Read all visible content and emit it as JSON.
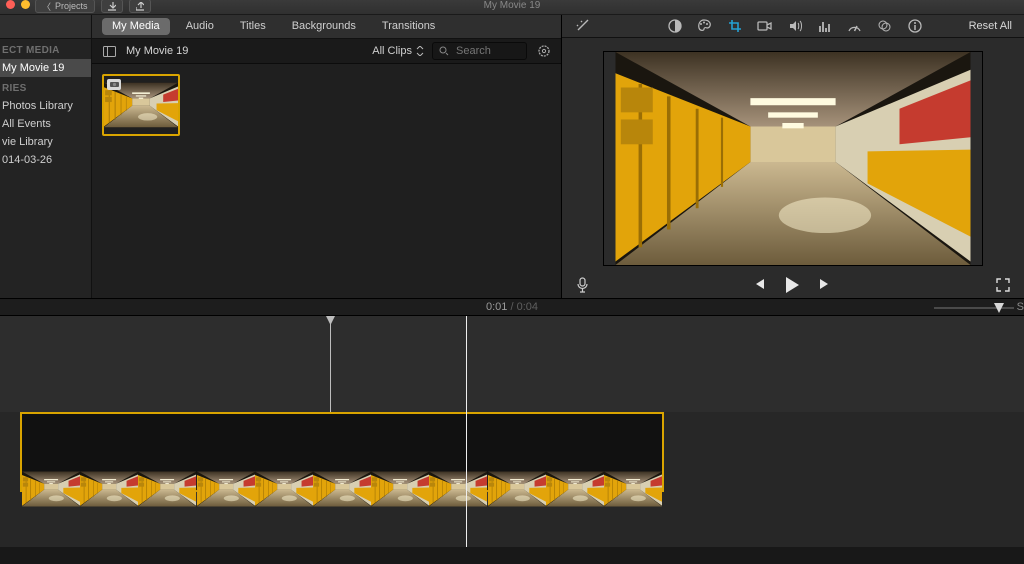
{
  "window": {
    "title": "My Movie 19",
    "back_label": "Projects"
  },
  "tabs": {
    "items": [
      "My Media",
      "Audio",
      "Titles",
      "Backgrounds",
      "Transitions"
    ],
    "active": 0
  },
  "sidebar": {
    "hdr_media": "ECT MEDIA",
    "project": "My Movie 19",
    "hdr_libs": "RIES",
    "items": [
      "Photos Library",
      "All Events",
      "vie Library",
      "014-03-26"
    ]
  },
  "browser": {
    "project_name": "My Movie 19",
    "filter_label": "All Clips",
    "search_placeholder": "Search"
  },
  "viewer": {
    "reset_label": "Reset All",
    "tool_icons": [
      "wand-icon",
      "balance-icon",
      "palette-icon",
      "crop-icon",
      "camcorder-icon",
      "volume-icon",
      "eq-icon",
      "speed-icon",
      "filters-icon",
      "info-icon"
    ],
    "active_tool_index": 3
  },
  "transport": {
    "mic": "mic-icon"
  },
  "timeline": {
    "current": "0:01",
    "total": "0:04",
    "settings_hint": "S",
    "clip_frames": 11
  },
  "colors": {
    "selection": "#d9a400",
    "audio": "#1a46e6",
    "accent": "#24a1d4"
  }
}
